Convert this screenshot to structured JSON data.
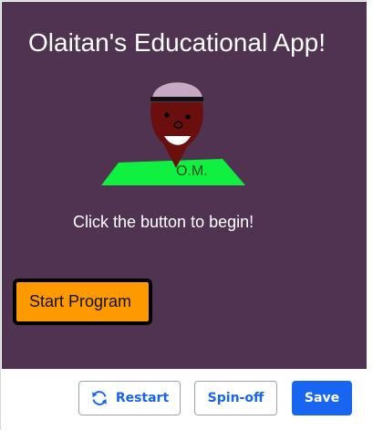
{
  "canvas": {
    "title": "Olaitan's Educational App!",
    "avatar_initials": "O.M.",
    "prompt": "Click the button to begin!",
    "start_button_label": "Start Program",
    "background_color": "#4f3350",
    "accent_color": "#ff9900"
  },
  "toolbar": {
    "restart_label": "Restart",
    "restart_icon": "refresh-icon",
    "spinoff_label": "Spin-off",
    "save_label": "Save",
    "primary_color": "#1865f2"
  }
}
